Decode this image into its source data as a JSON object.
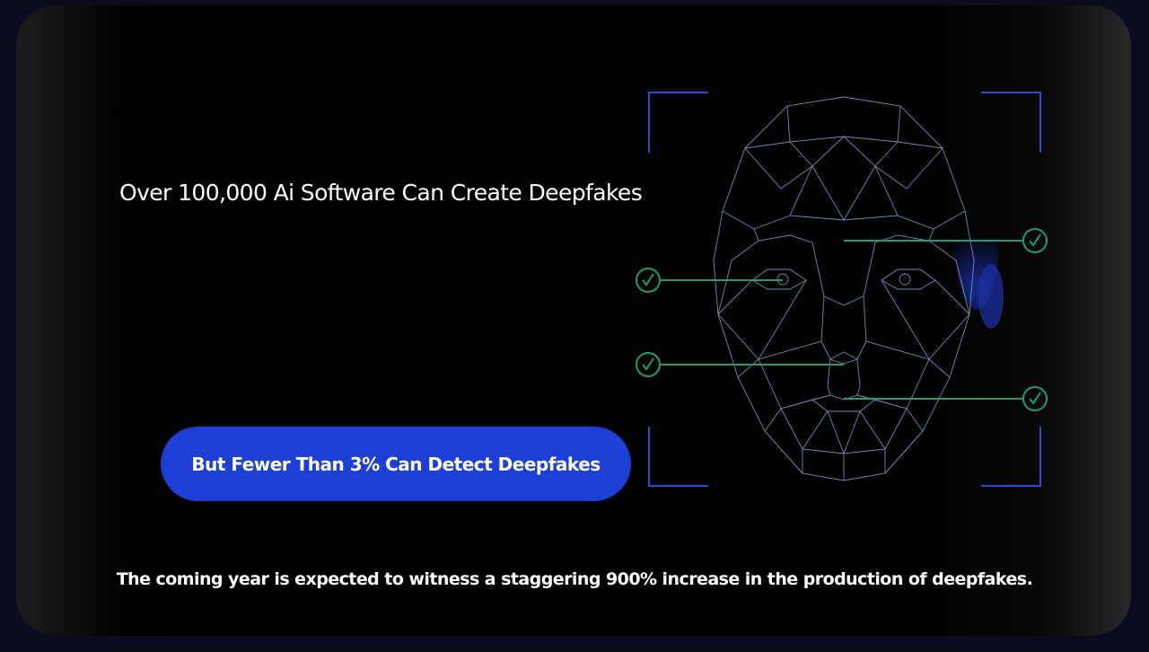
{
  "hero": {
    "headline": "Over 100,000 Ai Software Can Create Deepfakes",
    "cta_label": "But Fewer Than 3% Can Detect Deepfakes",
    "footnote": "The coming year is expected to witness a staggering 900% increase in the production of deepfakes."
  },
  "illustration": {
    "subject": "wireframe-face-scan",
    "marker_icon": "check-circle-icon",
    "marker_count": 4
  },
  "colors": {
    "page_background": "#0b0a1f",
    "card_background": "#000000",
    "cta_background": "#1d3fd6",
    "scan_bracket": "#2e4bd0",
    "face_wire": "#8da0c8",
    "check_marker": "#1f9b78",
    "text": "#ffffff"
  }
}
